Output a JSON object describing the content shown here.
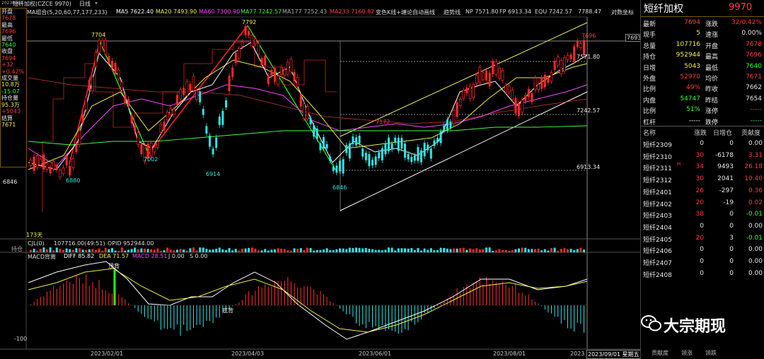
{
  "topbar": {
    "date_tag": "20230901",
    "title": "短纤加权(CZCE 9970)",
    "period": "日线",
    "icon_a": "chart-icon",
    "icon_b": "dropdown-icon"
  },
  "ma_bar": {
    "combo": "MA组合(5,20,60,77,177,233)",
    "ma5": "MA5 7622.40",
    "ma20": "MA20 7493.90",
    "ma60": "MA60 7300.90",
    "ma77": "MA77 7242.57",
    "ma177": "MA177 7252.43",
    "ma233": "MA233 7160.82",
    "indicator": "变色K线+缠论自动画线",
    "trend": "趋势线",
    "np": "NP 7571.80",
    "fp": "FP 6913.34",
    "equ": "EQU 7242.57",
    "last": "7788.47",
    "coord": "对数坐标",
    "colors": {
      "ma5": "#ffffff",
      "ma20": "#ffff40",
      "ma60": "#ff40ff",
      "ma77": "#40ff40",
      "ma177": "#aaaaaa",
      "ma233": "#ff4040"
    }
  },
  "left_info": [
    {
      "t": "开盘",
      "c": "white"
    },
    {
      "t": "7678",
      "c": "red"
    },
    {
      "t": "最高",
      "c": "white"
    },
    {
      "t": "7696",
      "c": "red"
    },
    {
      "t": "最低",
      "c": "white"
    },
    {
      "t": "7640",
      "c": "green"
    },
    {
      "t": "收盘",
      "c": "white"
    },
    {
      "t": "7694",
      "c": "red"
    },
    {
      "t": "+32",
      "c": "red"
    },
    {
      "t": "+0.42%",
      "c": "red"
    },
    {
      "t": "成交量",
      "c": "white"
    },
    {
      "t": "10.8万",
      "c": "yellow"
    },
    {
      "t": "-15.07",
      "c": "green"
    },
    {
      "t": "持仓量",
      "c": "white"
    },
    {
      "t": "95.3万",
      "c": "yellow"
    },
    {
      "t": "+5043",
      "c": "red"
    },
    {
      "t": "结算",
      "c": "white"
    },
    {
      "t": "7671",
      "c": "yellow"
    }
  ],
  "price_labels": {
    "p7704": "7704",
    "p7792": "7792",
    "p7696": "7696",
    "p7693": "7693",
    "p7571": "7571.80",
    "p7242": "7242.57",
    "p7172": "7172",
    "p7002": "7002",
    "p6914": "6914",
    "p6880": "6880",
    "p6846": "6846",
    "p6913": "6913.34",
    "axis6846": "6846"
  },
  "volume": {
    "days": "173天",
    "label": "CJL(0)",
    "cjl": "107716.00(49:51)",
    "opid": "OPID 952944.00",
    "side": "持仓"
  },
  "macd": {
    "label": "MACD背离",
    "diff": "DIFF 85.82",
    "dea": "DEA 71.57",
    "macd": "MACD 28.51",
    "j": "J 0.00",
    "s": "S 0.00",
    "top_tag": "顶背",
    "bottom_tag": "底背",
    "axis_neg100": "-100",
    "axis_100": "100"
  },
  "dates": [
    "2023/02/01",
    "2023/04/03",
    "2023/06/01",
    "2023/08/01",
    "2023/09/01 星期五"
  ],
  "date_cut": "2023",
  "quote": {
    "title": "短纤加权",
    "code": "9970",
    "rows": [
      {
        "l1": "最新",
        "v1": "7694",
        "c1": "red",
        "l2": "涨跌",
        "v2": "32/0.42%",
        "c2": "red"
      },
      {
        "l1": "现手",
        "v1": "5",
        "c1": "yellow",
        "l2": "速涨",
        "v2": "0.00%",
        "c2": "white"
      },
      {
        "l1": "总量",
        "v1": "107716",
        "c1": "yellow",
        "l2": "开盘",
        "v2": "7678",
        "c2": "red"
      },
      {
        "l1": "持仓",
        "v1": "952944",
        "c1": "yellow",
        "l2": "最高",
        "v2": "7696",
        "c2": "red"
      },
      {
        "l1": "日增",
        "v1": "5043",
        "c1": "yellow",
        "l2": "最低",
        "v2": "7640",
        "c2": "green"
      },
      {
        "l1": "外盘",
        "v1": "52970",
        "c1": "red",
        "l2": "均价",
        "v2": "7671",
        "c2": "red"
      },
      {
        "l1": "比例",
        "v1": "49%",
        "c1": "red",
        "l2": "昨收",
        "v2": "7662",
        "c2": "white"
      },
      {
        "l1": "内盘",
        "v1": "54747",
        "c1": "green",
        "l2": "昨结",
        "v2": "7654",
        "c2": "white"
      },
      {
        "l1": "比例",
        "v1": "51%",
        "c1": "green",
        "l2": "涨停",
        "v2": "-----",
        "c2": "red"
      },
      {
        "l1": "杠杆",
        "v1": "-----",
        "c1": "white",
        "l2": "跌停",
        "v2": "-----",
        "c2": "green"
      }
    ]
  },
  "futures": {
    "headers": {
      "name": "名称",
      "change": "涨跌",
      "oi": "日增仓",
      "contrib": "贡献度"
    },
    "rows": [
      {
        "name": "短纤2309",
        "tag": "",
        "change": "0",
        "cc": "white",
        "oi": "0",
        "oc": "white",
        "contrib": "0.00",
        "ctc": "white"
      },
      {
        "name": "短纤2310",
        "tag": "",
        "change": "30",
        "cc": "red",
        "oi": "-6178",
        "oc": "white",
        "contrib": "3.31",
        "ctc": "red"
      },
      {
        "name": "短纤2311",
        "tag": "M",
        "change": "34",
        "cc": "red",
        "oi": "9493",
        "oc": "white",
        "contrib": "26.18",
        "ctc": "red"
      },
      {
        "name": "短纤2312",
        "tag": "",
        "change": "30",
        "cc": "red",
        "oi": "2041",
        "oc": "white",
        "contrib": "10.40",
        "ctc": "red"
      },
      {
        "name": "短纤2401",
        "tag": "",
        "change": "26",
        "cc": "red",
        "oi": "-297",
        "oc": "white",
        "contrib": "0.36",
        "ctc": "red"
      },
      {
        "name": "短纤2402",
        "tag": "",
        "change": "20",
        "cc": "red",
        "oi": "-19",
        "oc": "white",
        "contrib": "0.02",
        "ctc": "red"
      },
      {
        "name": "短纤2403",
        "tag": "",
        "change": "38",
        "cc": "red",
        "oi": "0",
        "oc": "white",
        "contrib": "-0.01",
        "ctc": "green"
      },
      {
        "name": "短纤2404",
        "tag": "",
        "change": "0",
        "cc": "white",
        "oi": "0",
        "oc": "white",
        "contrib": "0.00",
        "ctc": "white"
      },
      {
        "name": "短纤2405",
        "tag": "",
        "change": "20",
        "cc": "red",
        "oi": "3",
        "oc": "white",
        "contrib": "-0.01",
        "ctc": "green"
      },
      {
        "name": "短纤2406",
        "tag": "",
        "change": "0",
        "cc": "white",
        "oi": "0",
        "oc": "white",
        "contrib": "0.00",
        "ctc": "white"
      },
      {
        "name": "短纤2407",
        "tag": "",
        "change": "0",
        "cc": "white",
        "oi": "0",
        "oc": "white",
        "contrib": "0.00",
        "ctc": "white"
      },
      {
        "name": "短纤2408",
        "tag": "",
        "change": "0",
        "cc": "white",
        "oi": "0",
        "oc": "white",
        "contrib": "0.00",
        "ctc": "white"
      }
    ]
  },
  "watermark": {
    "text": "大宗期现",
    "icon": "wechat-icon"
  },
  "bottom_tabs": [
    "贡献度",
    "领涨",
    "领跌"
  ]
}
